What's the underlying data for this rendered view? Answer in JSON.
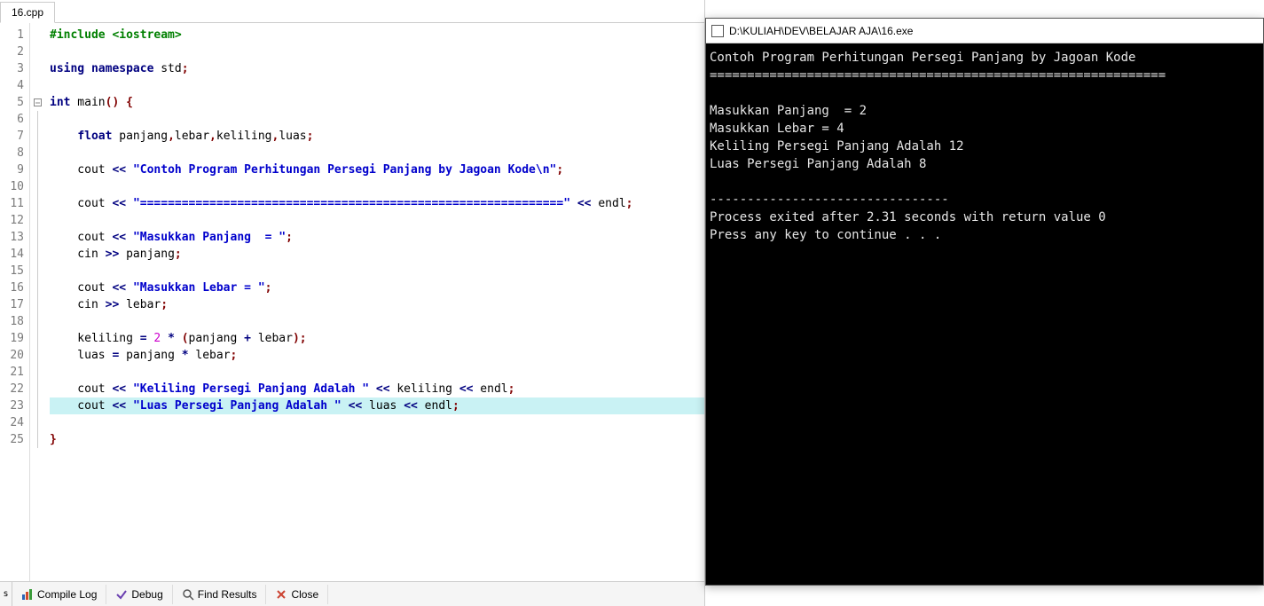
{
  "editor": {
    "tab_name": "16.cpp",
    "highlight_line": 23,
    "fold_line": 5,
    "lines": [
      [
        {
          "cls": "tk-pp",
          "t": "#include <iostream>"
        }
      ],
      [],
      [
        {
          "cls": "tk-kw",
          "t": "using namespace"
        },
        {
          "cls": "tk-id",
          "t": " std"
        },
        {
          "cls": "tk-pn",
          "t": ";"
        }
      ],
      [],
      [
        {
          "cls": "tk-kw",
          "t": "int"
        },
        {
          "cls": "tk-id",
          "t": " main"
        },
        {
          "cls": "tk-br",
          "t": "()"
        },
        {
          "cls": "tk-id",
          "t": " "
        },
        {
          "cls": "tk-br",
          "t": "{"
        }
      ],
      [],
      [
        {
          "cls": "tk-id",
          "t": "    "
        },
        {
          "cls": "tk-kw",
          "t": "float"
        },
        {
          "cls": "tk-id",
          "t": " panjang"
        },
        {
          "cls": "tk-pn",
          "t": ","
        },
        {
          "cls": "tk-id",
          "t": "lebar"
        },
        {
          "cls": "tk-pn",
          "t": ","
        },
        {
          "cls": "tk-id",
          "t": "keliling"
        },
        {
          "cls": "tk-pn",
          "t": ","
        },
        {
          "cls": "tk-id",
          "t": "luas"
        },
        {
          "cls": "tk-pn",
          "t": ";"
        }
      ],
      [],
      [
        {
          "cls": "tk-id",
          "t": "    cout "
        },
        {
          "cls": "tk-op",
          "t": "<<"
        },
        {
          "cls": "tk-id",
          "t": " "
        },
        {
          "cls": "tk-str",
          "t": "\"Contoh Program Perhitungan Persegi Panjang by Jagoan Kode\\n\""
        },
        {
          "cls": "tk-pn",
          "t": ";"
        }
      ],
      [],
      [
        {
          "cls": "tk-id",
          "t": "    cout "
        },
        {
          "cls": "tk-op",
          "t": "<<"
        },
        {
          "cls": "tk-id",
          "t": " "
        },
        {
          "cls": "tk-str",
          "t": "\"=============================================================\""
        },
        {
          "cls": "tk-id",
          "t": " "
        },
        {
          "cls": "tk-op",
          "t": "<<"
        },
        {
          "cls": "tk-id",
          "t": " endl"
        },
        {
          "cls": "tk-pn",
          "t": ";"
        }
      ],
      [],
      [
        {
          "cls": "tk-id",
          "t": "    cout "
        },
        {
          "cls": "tk-op",
          "t": "<<"
        },
        {
          "cls": "tk-id",
          "t": " "
        },
        {
          "cls": "tk-str",
          "t": "\"Masukkan Panjang  = \""
        },
        {
          "cls": "tk-pn",
          "t": ";"
        }
      ],
      [
        {
          "cls": "tk-id",
          "t": "    cin "
        },
        {
          "cls": "tk-op",
          "t": ">>"
        },
        {
          "cls": "tk-id",
          "t": " panjang"
        },
        {
          "cls": "tk-pn",
          "t": ";"
        }
      ],
      [],
      [
        {
          "cls": "tk-id",
          "t": "    cout "
        },
        {
          "cls": "tk-op",
          "t": "<<"
        },
        {
          "cls": "tk-id",
          "t": " "
        },
        {
          "cls": "tk-str",
          "t": "\"Masukkan Lebar = \""
        },
        {
          "cls": "tk-pn",
          "t": ";"
        }
      ],
      [
        {
          "cls": "tk-id",
          "t": "    cin "
        },
        {
          "cls": "tk-op",
          "t": ">>"
        },
        {
          "cls": "tk-id",
          "t": " lebar"
        },
        {
          "cls": "tk-pn",
          "t": ";"
        }
      ],
      [],
      [
        {
          "cls": "tk-id",
          "t": "    keliling "
        },
        {
          "cls": "tk-op",
          "t": "="
        },
        {
          "cls": "tk-id",
          "t": " "
        },
        {
          "cls": "tk-num",
          "t": "2"
        },
        {
          "cls": "tk-id",
          "t": " "
        },
        {
          "cls": "tk-op",
          "t": "*"
        },
        {
          "cls": "tk-id",
          "t": " "
        },
        {
          "cls": "tk-br",
          "t": "("
        },
        {
          "cls": "tk-id",
          "t": "panjang "
        },
        {
          "cls": "tk-op",
          "t": "+"
        },
        {
          "cls": "tk-id",
          "t": " lebar"
        },
        {
          "cls": "tk-br",
          "t": ")"
        },
        {
          "cls": "tk-pn",
          "t": ";"
        }
      ],
      [
        {
          "cls": "tk-id",
          "t": "    luas "
        },
        {
          "cls": "tk-op",
          "t": "="
        },
        {
          "cls": "tk-id",
          "t": " panjang "
        },
        {
          "cls": "tk-op",
          "t": "*"
        },
        {
          "cls": "tk-id",
          "t": " lebar"
        },
        {
          "cls": "tk-pn",
          "t": ";"
        }
      ],
      [],
      [
        {
          "cls": "tk-id",
          "t": "    cout "
        },
        {
          "cls": "tk-op",
          "t": "<<"
        },
        {
          "cls": "tk-id",
          "t": " "
        },
        {
          "cls": "tk-str",
          "t": "\"Keliling Persegi Panjang Adalah \""
        },
        {
          "cls": "tk-id",
          "t": " "
        },
        {
          "cls": "tk-op",
          "t": "<<"
        },
        {
          "cls": "tk-id",
          "t": " keliling "
        },
        {
          "cls": "tk-op",
          "t": "<<"
        },
        {
          "cls": "tk-id",
          "t": " endl"
        },
        {
          "cls": "tk-pn",
          "t": ";"
        }
      ],
      [
        {
          "cls": "tk-id",
          "t": "    cout "
        },
        {
          "cls": "tk-op",
          "t": "<<"
        },
        {
          "cls": "tk-id",
          "t": " "
        },
        {
          "cls": "tk-str",
          "t": "\"Luas Persegi Panjang Adalah \""
        },
        {
          "cls": "tk-id",
          "t": " "
        },
        {
          "cls": "tk-op",
          "t": "<<"
        },
        {
          "cls": "tk-id",
          "t": " luas "
        },
        {
          "cls": "tk-op",
          "t": "<<"
        },
        {
          "cls": "tk-id",
          "t": " endl"
        },
        {
          "cls": "tk-pn",
          "t": ";"
        }
      ],
      [],
      [
        {
          "cls": "tk-br",
          "t": "}"
        }
      ]
    ]
  },
  "bottom_tabs": {
    "left_edge": "s",
    "compile_log": "Compile Log",
    "debug": "Debug",
    "find_results": "Find Results",
    "close": "Close"
  },
  "console": {
    "title": "D:\\KULIAH\\DEV\\BELAJAR AJA\\16.exe",
    "lines": [
      "Contoh Program Perhitungan Persegi Panjang by Jagoan Kode",
      "=============================================================",
      "",
      "Masukkan Panjang  = 2",
      "Masukkan Lebar = 4",
      "Keliling Persegi Panjang Adalah 12",
      "Luas Persegi Panjang Adalah 8",
      "",
      "--------------------------------",
      "Process exited after 2.31 seconds with return value 0",
      "Press any key to continue . . ."
    ]
  }
}
